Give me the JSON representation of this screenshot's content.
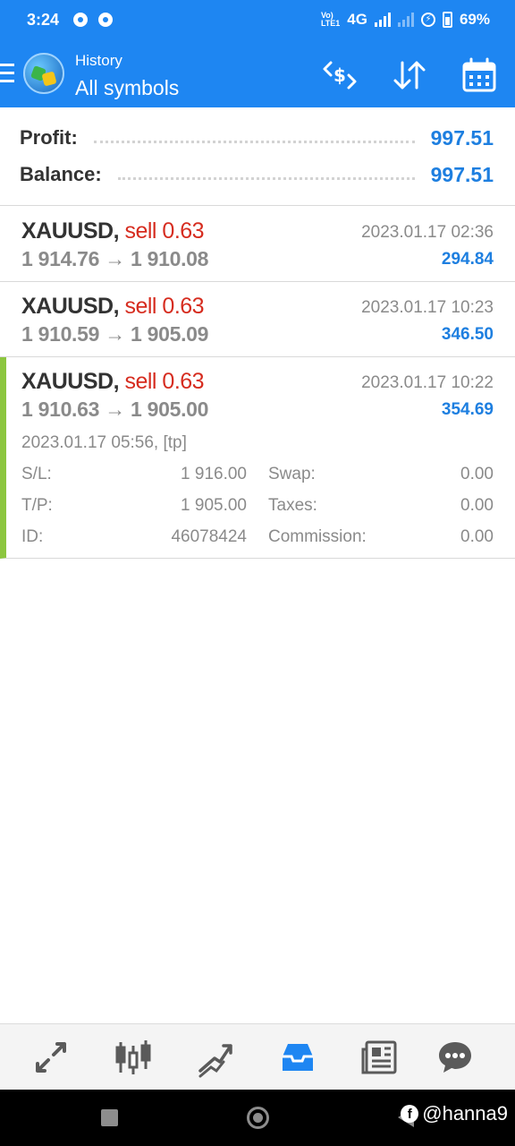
{
  "status_bar": {
    "time": "3:24",
    "lte_label": "Vo)) LTE1",
    "network": "4G",
    "battery": "69%"
  },
  "app_bar": {
    "subtitle": "History",
    "title": "All symbols",
    "icons": [
      "exchange-dollar-icon",
      "sort-icon",
      "calendar-icon"
    ]
  },
  "summary": {
    "profit_label": "Profit:",
    "profit_value": "997.51",
    "balance_label": "Balance:",
    "balance_value": "997.51"
  },
  "deals": [
    {
      "symbol": "XAUUSD,",
      "type": "sell 0.63",
      "prices": "1 914.76 → 1 910.08",
      "time": "2023.01.17 02:36",
      "profit": "294.84"
    },
    {
      "symbol": "XAUUSD,",
      "type": "sell 0.63",
      "prices": "1 910.59 → 1 905.09",
      "time": "2023.01.17 10:23",
      "profit": "346.50"
    },
    {
      "symbol": "XAUUSD,",
      "type": "sell 0.63",
      "prices": "1 910.63 → 1 905.00",
      "time": "2023.01.17 10:22",
      "profit": "354.69",
      "open_info": "2023.01.17 05:56, [tp]",
      "details": {
        "sl_label": "S/L:",
        "sl_value": "1 916.00",
        "tp_label": "T/P:",
        "tp_value": "1 905.00",
        "id_label": "ID:",
        "id_value": "46078424",
        "swap_label": "Swap:",
        "swap_value": "0.00",
        "taxes_label": "Taxes:",
        "taxes_value": "0.00",
        "commission_label": "Commission:",
        "commission_value": "0.00"
      }
    }
  ],
  "bottom_nav": {
    "items": [
      "quotes-icon",
      "chart-icon",
      "trade-icon",
      "history-icon",
      "news-icon",
      "messages-icon"
    ],
    "active": "history-icon"
  },
  "watermark": {
    "text": "@hanna9"
  },
  "colors": {
    "primary": "#1e86f2",
    "profit_blue": "#1e7fe0",
    "sell_red": "#d62c1f",
    "selected_green": "#8cc63f"
  }
}
